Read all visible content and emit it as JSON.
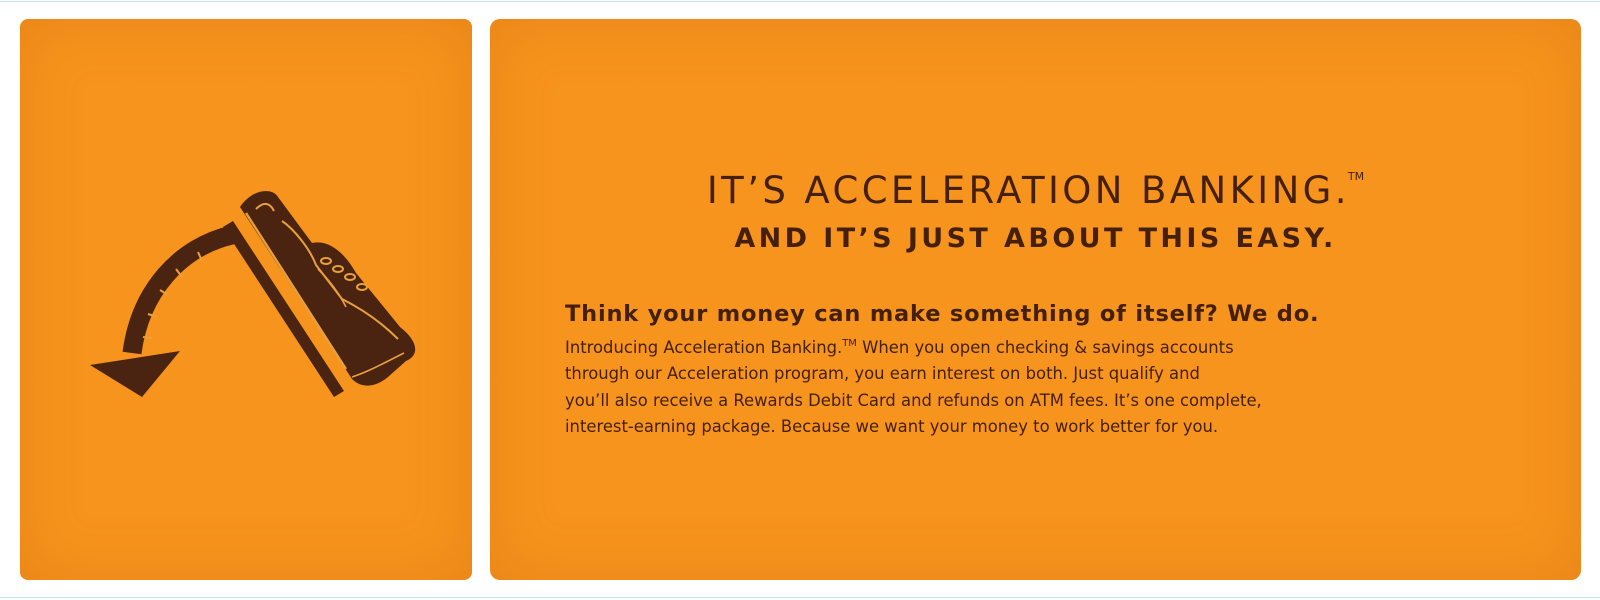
{
  "colors": {
    "panel_orange": "#f7941d",
    "text_brown": "#44200c",
    "shoe_dark": "#4a2410",
    "accent_tan": "#e8a03c"
  },
  "illustration": {
    "icon": "shoe-kicking-arrow-icon"
  },
  "headline": {
    "line1": "IT’S ACCELERATION BANKING.",
    "line1_mark": "TM",
    "line2": "AND IT’S JUST ABOUT THIS EASY."
  },
  "body": {
    "lead": "Think your money can make something of itself? We do.",
    "para_intro": "Introducing Acceleration Banking.",
    "para_intro_mark": "TM",
    "para_intro_rest": " When you open checking & savings accounts",
    "para_line2": "through our Acceleration program, you earn interest on both. Just qualify and",
    "para_line3": "you’ll also receive a Rewards Debit Card and refunds on ATM fees. It’s one complete,",
    "para_line4": "interest-earning package. Because we want your money to work better for you."
  }
}
